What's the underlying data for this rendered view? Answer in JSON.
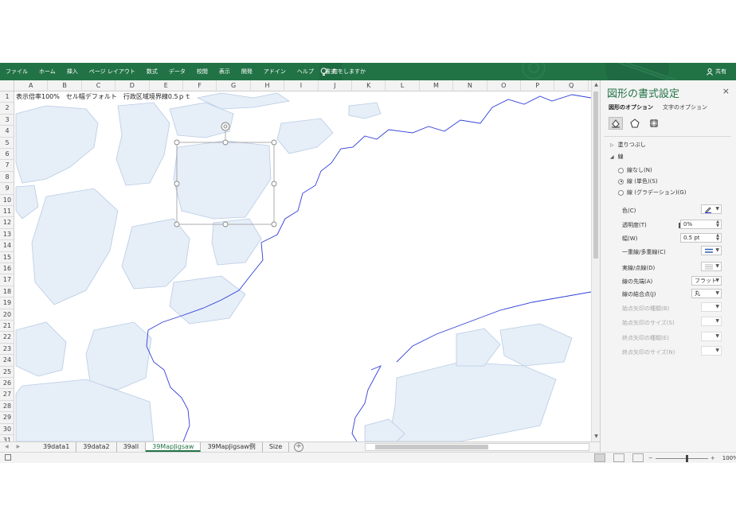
{
  "ribbon": {
    "tabs": [
      "ファイル",
      "ホーム",
      "挿入",
      "ページ レイアウト",
      "数式",
      "データ",
      "校閲",
      "表示",
      "開発",
      "アドイン",
      "ヘルプ",
      "書式"
    ],
    "active_tab": "書式",
    "tell_me": "何をしますか",
    "share": "共有",
    "color": "#217346"
  },
  "grid": {
    "columns": [
      "A",
      "B",
      "C",
      "D",
      "E",
      "F",
      "G",
      "H",
      "I",
      "J",
      "K",
      "L",
      "M",
      "N",
      "O",
      "P",
      "Q"
    ],
    "rows": [
      "1",
      "2",
      "3",
      "4",
      "5",
      "6",
      "7",
      "8",
      "9",
      "10",
      "11",
      "12",
      "13",
      "14",
      "15",
      "16",
      "17",
      "18",
      "19",
      "20",
      "21",
      "22",
      "23",
      "24",
      "25",
      "26",
      "27",
      "28",
      "29",
      "30",
      "31"
    ],
    "cell_a1": "表示倍率100%　セル幅デフォルト　行政区域境界線0.5ｐｔ"
  },
  "sheet_tabs": {
    "nav": [
      "◀",
      "▶"
    ],
    "tabs": [
      "39data1",
      "39data2",
      "39all",
      "39MapJigsaw",
      "39MapJigsaw例",
      "Size"
    ],
    "active": "39MapJigsaw",
    "add": "+"
  },
  "status": {
    "zoom": "100%",
    "zoom_minus": "−",
    "zoom_plus": "+"
  },
  "format_pane": {
    "title": "図形の書式設定",
    "close": "×",
    "tabs": [
      "図形のオプション",
      "文字のオプション"
    ],
    "active_tab": "図形のオプション",
    "icons": [
      "fill-line-icon",
      "effects-icon",
      "size-properties-icon"
    ],
    "sections": {
      "fill": "塗りつぶし",
      "line": "線"
    },
    "line_options": [
      "線なし(N)",
      "線 (単色)(S)",
      "線 (グラデーション)(G)"
    ],
    "line_selected": "線 (単色)(S)",
    "props": {
      "color_label": "色(C)",
      "transparency_label": "透明度(T)",
      "transparency_value": "0%",
      "width_label": "幅(W)",
      "width_value": "0.5 pt",
      "compound_label": "一重線/多重線(C)",
      "dash_label": "実線/点線(D)",
      "cap_label": "線の先端(A)",
      "cap_value": "フラット",
      "join_label": "線の結合点(J)",
      "join_value": "丸",
      "begin_arrow_type_label": "始点矢印の種類(B)",
      "begin_arrow_size_label": "始点矢印のサイズ(S)",
      "end_arrow_type_label": "終点矢印の種類(E)",
      "end_arrow_size_label": "終点矢印のサイズ(N)"
    },
    "line_color": "#2f3ed8"
  }
}
